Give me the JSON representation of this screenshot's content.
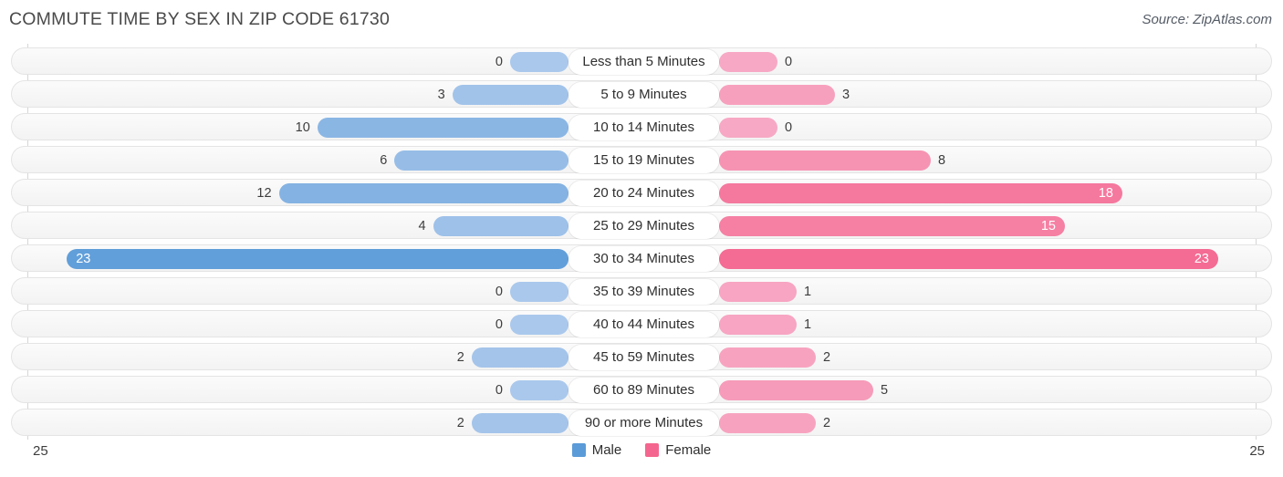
{
  "header": {
    "title": "COMMUTE TIME BY SEX IN ZIP CODE 61730",
    "source": "Source: ZipAtlas.com"
  },
  "legend": {
    "items": [
      {
        "label": "Male",
        "color": "#5b9bd8"
      },
      {
        "label": "Female",
        "color": "#f4668f"
      }
    ]
  },
  "axis": {
    "left_tick": "25",
    "right_tick": "25"
  },
  "chart_data": {
    "type": "bar",
    "subtype": "diverging-bidirectional-bar",
    "title": "COMMUTE TIME BY SEX IN ZIP CODE 61730",
    "xlabel": "",
    "ylabel": "",
    "axis_max": 25,
    "xlim": [
      25,
      25
    ],
    "grid": false,
    "legend_position": "bottom-center",
    "categories": [
      "Less than 5 Minutes",
      "5 to 9 Minutes",
      "10 to 14 Minutes",
      "15 to 19 Minutes",
      "20 to 24 Minutes",
      "25 to 29 Minutes",
      "30 to 34 Minutes",
      "35 to 39 Minutes",
      "40 to 44 Minutes",
      "45 to 59 Minutes",
      "60 to 89 Minutes",
      "90 or more Minutes"
    ],
    "series": [
      {
        "name": "Male",
        "color": "#5b9bd8",
        "direction": "left",
        "values": [
          0,
          3,
          10,
          6,
          12,
          4,
          23,
          0,
          0,
          2,
          0,
          2
        ]
      },
      {
        "name": "Female",
        "color": "#f4668f",
        "direction": "right",
        "values": [
          0,
          3,
          0,
          8,
          18,
          15,
          23,
          1,
          1,
          2,
          5,
          2
        ]
      }
    ]
  },
  "rows": [
    {
      "label": "Less than 5 Minutes",
      "male": "0",
      "female": "0"
    },
    {
      "label": "5 to 9 Minutes",
      "male": "3",
      "female": "3"
    },
    {
      "label": "10 to 14 Minutes",
      "male": "10",
      "female": "0"
    },
    {
      "label": "15 to 19 Minutes",
      "male": "6",
      "female": "8"
    },
    {
      "label": "20 to 24 Minutes",
      "male": "12",
      "female": "18"
    },
    {
      "label": "25 to 29 Minutes",
      "male": "4",
      "female": "15"
    },
    {
      "label": "30 to 34 Minutes",
      "male": "23",
      "female": "23"
    },
    {
      "label": "35 to 39 Minutes",
      "male": "0",
      "female": "1"
    },
    {
      "label": "40 to 44 Minutes",
      "male": "0",
      "female": "1"
    },
    {
      "label": "45 to 59 Minutes",
      "male": "2",
      "female": "2"
    },
    {
      "label": "60 to 89 Minutes",
      "male": "0",
      "female": "5"
    },
    {
      "label": "90 or more Minutes",
      "male": "2",
      "female": "2"
    }
  ]
}
